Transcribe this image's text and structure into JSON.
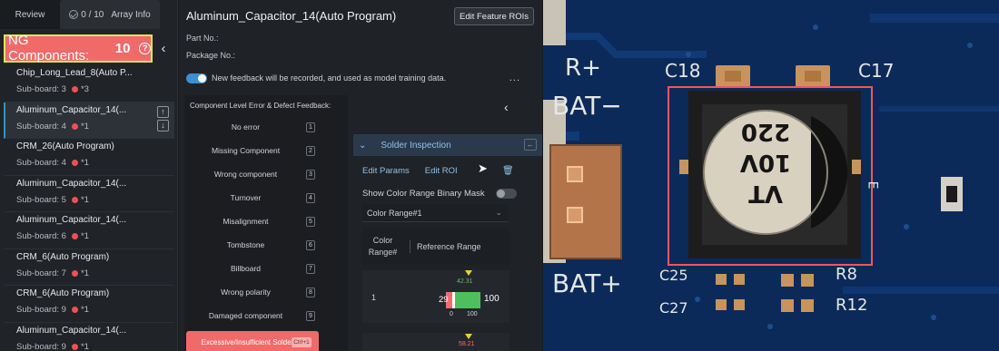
{
  "tabs": {
    "review": "Review",
    "array_count": "0 / 10",
    "array_info": "Array Info"
  },
  "ng": {
    "label": "NG Components:",
    "count": "10",
    "help": "?"
  },
  "components": [
    {
      "name": "Chip_Long_Lead_8(Auto P...",
      "sub": "Sub-board: 3",
      "count": "*3"
    },
    {
      "name": "Aluminum_Capacitor_14(...",
      "sub": "Sub-board: 4",
      "count": "*1"
    },
    {
      "name": "CRM_26(Auto Program)",
      "sub": "Sub-board: 4",
      "count": "*1"
    },
    {
      "name": "Aluminum_Capacitor_14(...",
      "sub": "Sub-board: 5",
      "count": "*1"
    },
    {
      "name": "Aluminum_Capacitor_14(...",
      "sub": "Sub-board: 6",
      "count": "*1"
    },
    {
      "name": "CRM_6(Auto Program)",
      "sub": "Sub-board: 7",
      "count": "*1"
    },
    {
      "name": "CRM_6(Auto Program)",
      "sub": "Sub-board: 9",
      "count": "*1"
    },
    {
      "name": "Aluminum_Capacitor_14(...",
      "sub": "Sub-board: 9",
      "count": "*1"
    }
  ],
  "header": {
    "title": "Aluminum_Capacitor_14(Auto Program)",
    "edit_btn": "Edit Feature ROIs",
    "part_no": "Part No.:",
    "package_no": "Package No.:",
    "feedback_text": "New feedback will be recorded, and used as model training data.",
    "more": "..."
  },
  "defects": {
    "title": "Component Level Error & Defect Feedback:",
    "items": [
      {
        "label": "No error",
        "key": "1"
      },
      {
        "label": "Missing Component",
        "key": "2"
      },
      {
        "label": "Wrong component",
        "key": "3"
      },
      {
        "label": "Turnover",
        "key": "4"
      },
      {
        "label": "Misalignment",
        "key": "5"
      },
      {
        "label": "Tombstone",
        "key": "6"
      },
      {
        "label": "Billboard",
        "key": "7"
      },
      {
        "label": "Wrong polarity",
        "key": "8"
      },
      {
        "label": "Damaged component",
        "key": "9"
      }
    ],
    "active_label": "Excessive/Insufficient Solder",
    "active_key": "Ctrl+1"
  },
  "inspection": {
    "title": "Solder Inspection",
    "edit_params": "Edit Params",
    "edit_roi": "Edit ROI",
    "mask_label": "Show Color Range Binary Mask",
    "select_value": "Color Range#1",
    "col1": "Color Range#",
    "col2": "Reference Range",
    "row1": {
      "index": "1",
      "value": "42.31",
      "low": "29",
      "high": "100",
      "axis_min": "0",
      "axis_max": "100"
    },
    "row2": {
      "value": "58.21"
    }
  },
  "board_labels": {
    "r_plus": "R+",
    "c18": "C18",
    "c17": "C17",
    "bat_minus": "BAT−",
    "bat_plus": "BAT+",
    "c25": "C25",
    "c27": "C27",
    "r8": "R8",
    "r12": "R12",
    "e": "E",
    "cap_line1": "VT",
    "cap_line2": "10V",
    "cap_line3": "220"
  },
  "colors": {
    "ng_red": "#f06a6a",
    "accent_blue": "#3c8fd1",
    "highlight_yellow": "#d7e85a",
    "pcb_blue": "#0b2a59"
  }
}
